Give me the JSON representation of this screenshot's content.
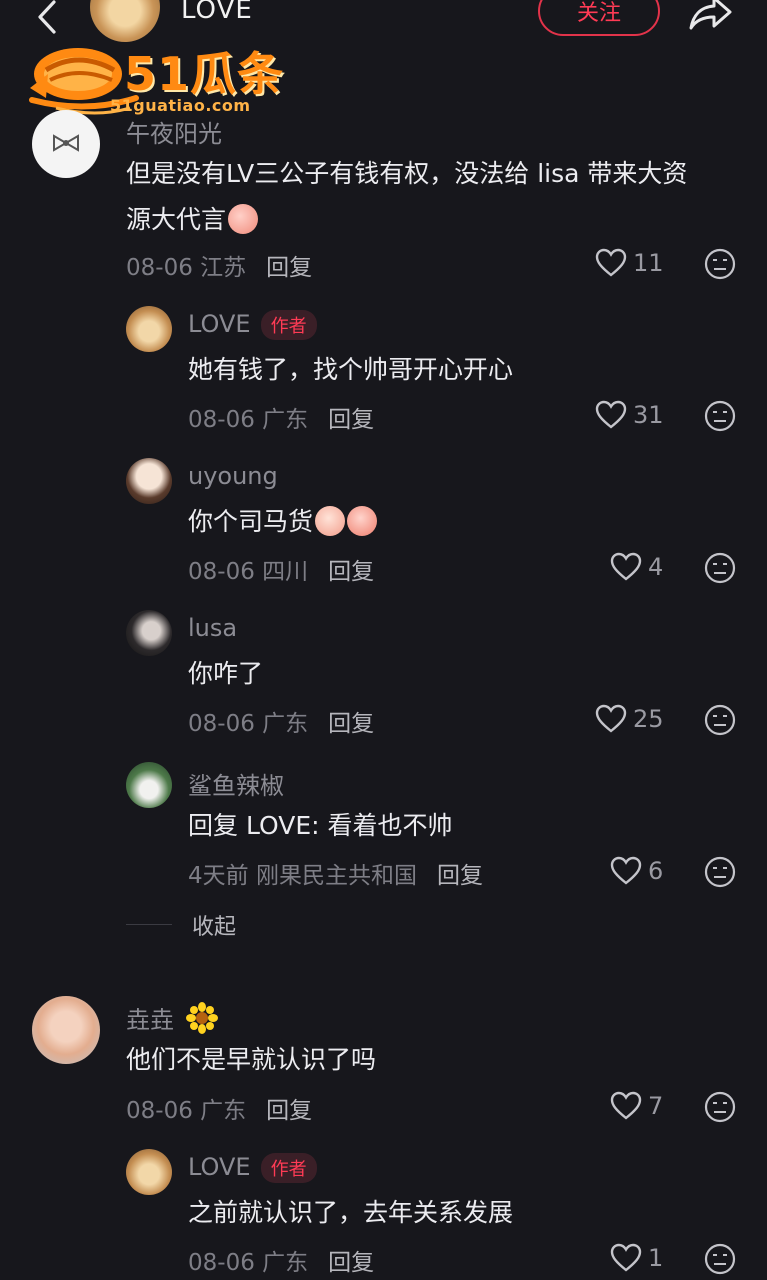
{
  "header": {
    "title": "LOVE",
    "follow_label": "关注"
  },
  "watermark": {
    "brand": "51瓜条",
    "url": "51guatiao.com"
  },
  "comments": [
    {
      "user": "午夜阳光",
      "text_l1": "但是没有LV三公子有钱有权，没法给 lisa 带来大资",
      "text_l2": "源大代言",
      "date": "08-06 江苏",
      "reply": "回复",
      "likes": "11"
    },
    {
      "user": "LOVE",
      "badge": "作者",
      "text": "她有钱了，找个帅哥开心开心",
      "date": "08-06 广东",
      "reply": "回复",
      "likes": "31"
    },
    {
      "user": "uyoung",
      "text": "你个司马货",
      "date": "08-06 四川",
      "reply": "回复",
      "likes": "4"
    },
    {
      "user": "lusa",
      "text": "你咋了",
      "date": "08-06 广东",
      "reply": "回复",
      "likes": "25"
    },
    {
      "user": "鲨鱼辣椒",
      "text": "回复 LOVE: 看着也不帅",
      "date": "4天前 刚果民主共和国",
      "reply": "回复",
      "likes": "6"
    },
    {
      "user": "垚垚",
      "text": "他们不是早就认识了吗",
      "date": "08-06 广东",
      "reply": "回复",
      "likes": "7"
    },
    {
      "user": "LOVE",
      "badge": "作者",
      "text": "之前就认识了，去年关系发展",
      "date": "08-06 广东",
      "reply": "回复",
      "likes": "1"
    }
  ],
  "collapse_label": "收起",
  "icons": {
    "back": "chevron-left-icon",
    "share": "share-arrow-icon",
    "like": "heart-outline-icon",
    "react": "neutral-face-icon"
  },
  "colors": {
    "background": "#17171c",
    "accent": "#ff3b55",
    "logo": "#ff8a12"
  }
}
